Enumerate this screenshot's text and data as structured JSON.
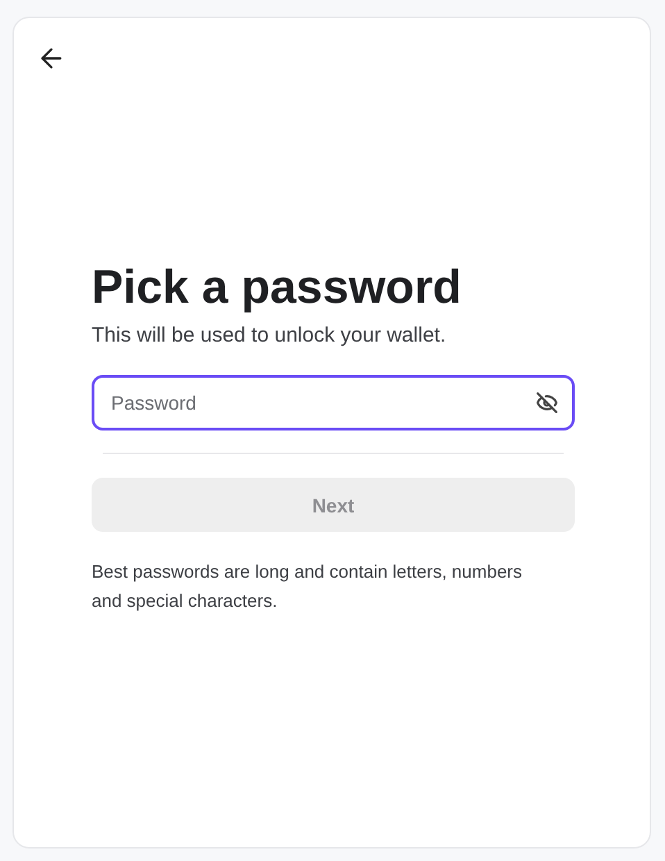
{
  "title": "Pick a password",
  "subtitle": "This will be used to unlock your wallet.",
  "password_field": {
    "placeholder": "Password",
    "focused": true
  },
  "next_button": {
    "label": "Next",
    "disabled": true
  },
  "hint": "Best passwords are long and contain letters, numbers and special characters."
}
